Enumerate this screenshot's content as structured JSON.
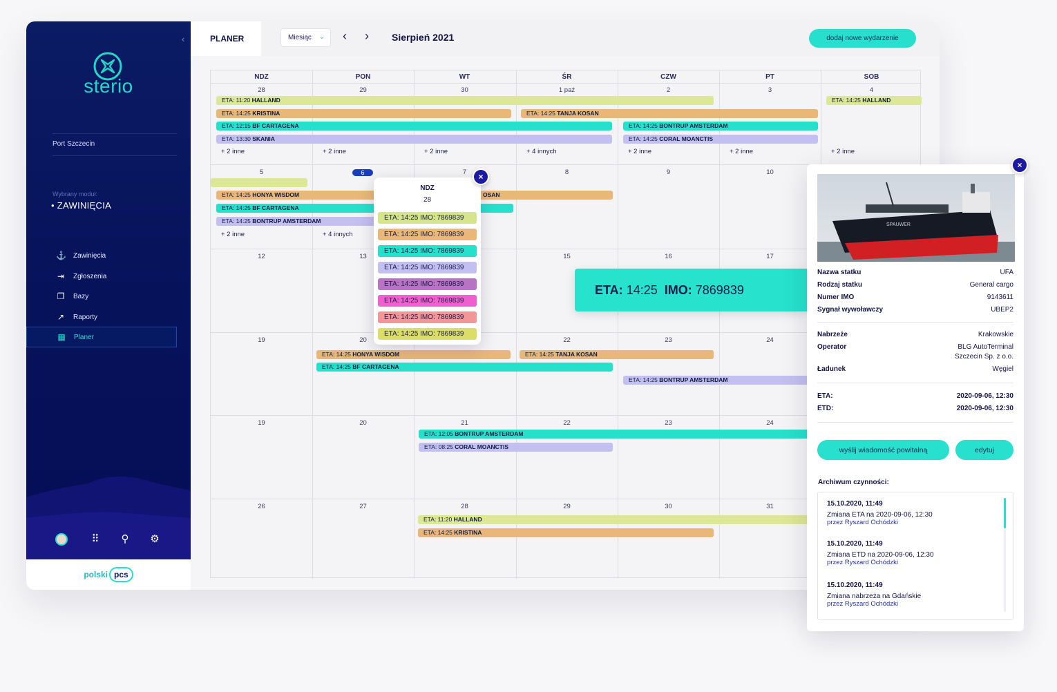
{
  "sidebar": {
    "brand": "sterio",
    "port": "Port Szczecin",
    "module_caption": "Wybrany moduł:",
    "module_value": "ZAWINIĘCIA",
    "items": [
      {
        "label": "Zawinięcia",
        "icon": "anchor-icon"
      },
      {
        "label": "Zgłoszenia",
        "icon": "login-icon"
      },
      {
        "label": "Bazy",
        "icon": "database-icon"
      },
      {
        "label": "Raporty",
        "icon": "report-icon"
      },
      {
        "label": "Planer",
        "icon": "calendar-icon"
      }
    ],
    "active_item": "Planer",
    "tools": [
      "user-icon",
      "apps-grid-icon",
      "location-icon",
      "settings-icon"
    ],
    "footer_logo": {
      "part1": "polski",
      "part2": "pcs"
    }
  },
  "topbar": {
    "section": "PLANER",
    "view_select": "Miesiąc",
    "prev": "‹",
    "next": "›",
    "month": "Sierpień 2021",
    "add_event": "dodaj nowe wydarzenie"
  },
  "calendar": {
    "weekdays": [
      "NDZ",
      "PON",
      "WT",
      "ŚR",
      "CZW",
      "PT",
      "SOB"
    ],
    "weeks": [
      [
        "28",
        "29",
        "30",
        "1 paź",
        "2",
        "3",
        "4"
      ],
      [
        "5",
        "6",
        "7",
        "8",
        "9",
        "10",
        ""
      ],
      [
        "12",
        "13",
        "",
        "15",
        "16",
        "17",
        ""
      ],
      [
        "19",
        "20",
        "",
        "22",
        "23",
        "24",
        ""
      ],
      [
        "19",
        "20",
        "21",
        "22",
        "23",
        "24",
        ""
      ],
      [
        "26",
        "27",
        "28",
        "29",
        "30",
        "31",
        ""
      ]
    ],
    "today": "6",
    "events": [
      {
        "time": "11:20",
        "name": "HALLAND"
      },
      {
        "time": "14:25",
        "name": "KRISTINA"
      },
      {
        "time": "14:25",
        "name": "TANJA KOSAN"
      },
      {
        "time": "12:15",
        "name": "BF CARTAGENA"
      },
      {
        "time": "14:25",
        "name": "BONTRUP AMSTERDAM"
      },
      {
        "time": "13:30",
        "name": "SKANIA"
      },
      {
        "time": "14:25",
        "name": "CORAL MOANCTIS"
      },
      {
        "time": "14:25",
        "name": "HALLAND"
      },
      {
        "time": "14:25",
        "name": "HONYA WISDOM"
      },
      {
        "time": "14:25",
        "name": "BF CARTAGENA"
      },
      {
        "time": "14:25",
        "name": "BONTRUP AMSTERDAM"
      },
      {
        "time": "14:25",
        "name": "HONYA WISDOM"
      },
      {
        "time": "14:25",
        "name": "TANJA KOSAN"
      },
      {
        "time": "14:25",
        "name": "BF CARTAGENA"
      },
      {
        "time": "14:25",
        "name": "BONTRUP AMSTERDAM"
      },
      {
        "time": "12:05",
        "name": "BONTRUP AMSTERDAM"
      },
      {
        "time": "08:25",
        "name": "CORAL MOANCTIS"
      },
      {
        "time": "11:20",
        "name": "HALLAND"
      },
      {
        "time": "14:25",
        "name": "KRISTINA"
      },
      {
        "time": "",
        "name": "OSAN"
      }
    ],
    "eta_prefix": "ETA:",
    "more": {
      "w1": [
        "+ 2 inne",
        "+ 2 inne",
        "+ 2 inne",
        "+ 4 innych",
        "+ 2 inne",
        "+ 2 inne",
        "+ 2 inne"
      ],
      "w2": [
        "+ 2 inne",
        "+ 4 innych"
      ]
    }
  },
  "day_popup": {
    "weekday": "NDZ",
    "day": "28",
    "close": "×",
    "item_text": "ETA: 14:25  IMO: 7869839",
    "item_colors": [
      "#d6e58c",
      "#e9b878",
      "#27e0cc",
      "#c3bff0",
      "#b873c4",
      "#ef5fcd",
      "#f49597",
      "#dadd68"
    ]
  },
  "tooltip": {
    "eta_label": "ETA:",
    "eta_value": "14:25",
    "imo_label": "IMO:",
    "imo_value": "7869839"
  },
  "detail": {
    "close": "×",
    "fields": [
      {
        "k": "Nazwa statku",
        "v": "UFA"
      },
      {
        "k": "Rodzaj statku",
        "v": "General cargo"
      },
      {
        "k": "Numer IMO",
        "v": "9143611"
      },
      {
        "k": "Sygnał wywoławczy",
        "v": "UBEP2"
      }
    ],
    "fields2": [
      {
        "k": "Nabrzeże",
        "v": "Krakowskie"
      },
      {
        "k": "Operator",
        "v": "BLG AutoTerminal",
        "v2": "Szczecin Sp. z o.o."
      },
      {
        "k": "Ładunek",
        "v": "Węgiel"
      }
    ],
    "eta": {
      "k": "ETA:",
      "v": "2020-09-06, 12:30"
    },
    "etd": {
      "k": "ETD:",
      "v": "2020-09-06, 12:30"
    },
    "btn_welcome": "wyślij wiadomość powitalną",
    "btn_edit": "edytuj",
    "archive_title": "Archiwum czynności:",
    "archive": [
      {
        "date": "15.10.2020, 11:49",
        "text": "Zmiana ETA na 2020-09-06, 12:30",
        "by": "przez  Ryszard Ochódzki"
      },
      {
        "date": "15.10.2020, 11:49",
        "text": "Zmiana ETD na 2020-09-06, 12:30",
        "by": "przez  Ryszard Ochódzki"
      },
      {
        "date": "15.10.2020, 11:49",
        "text": "Zmiana nabrzeża na Gdańskie",
        "by": "przez  Ryszard Ochódzki"
      }
    ],
    "ship_name_on_hull": "SPAUWER"
  }
}
